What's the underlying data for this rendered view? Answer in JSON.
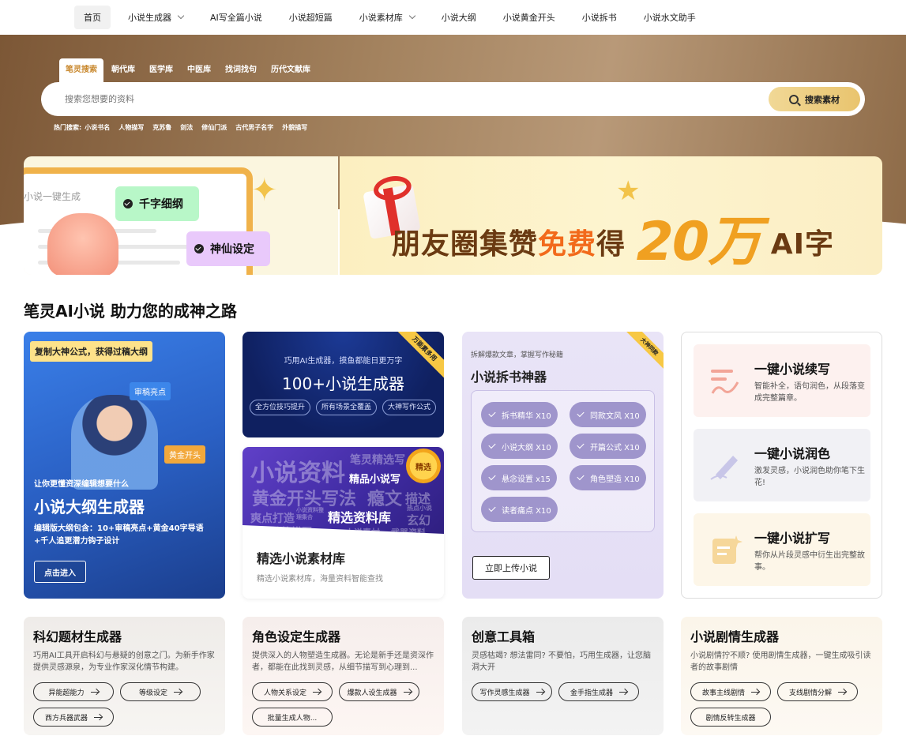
{
  "nav": {
    "items": [
      {
        "label": "首页",
        "dropdown": false,
        "active": true
      },
      {
        "label": "小说生成器",
        "dropdown": true,
        "active": false
      },
      {
        "label": "AI写全篇小说",
        "dropdown": false,
        "active": false
      },
      {
        "label": "小说超短篇",
        "dropdown": false,
        "active": false
      },
      {
        "label": "小说素材库",
        "dropdown": true,
        "active": false
      },
      {
        "label": "小说大纲",
        "dropdown": false,
        "active": false
      },
      {
        "label": "小说黄金开头",
        "dropdown": false,
        "active": false
      },
      {
        "label": "小说拆书",
        "dropdown": false,
        "active": false
      },
      {
        "label": "小说水文助手",
        "dropdown": false,
        "active": false
      }
    ]
  },
  "search": {
    "tabs": [
      "笔灵搜索",
      "朝代库",
      "医学库",
      "中医库",
      "找词找句",
      "历代文献库"
    ],
    "placeholder": "搜索您想要的资料",
    "button_label": "搜索素材",
    "hot_label": "热门搜索:",
    "hot_terms": [
      "小说书名",
      "人物描写",
      "克苏鲁",
      "剑法",
      "修仙门派",
      "古代男子名字",
      "外貌描写"
    ]
  },
  "banner_left": {
    "line_title": "小说一键生成",
    "tag1": "千字细纲",
    "tag2": "神仙设定"
  },
  "banner_right": {
    "text_part1": "朋友圈集赞",
    "text_free": "免费",
    "text_part2": "得",
    "text_big": "20万",
    "text_ai": "AI字"
  },
  "section_title": "笔灵AI小说 助力您的成神之路",
  "card_outline": {
    "badge": "复制大神公式，获得过稿大纲",
    "tag1": "审稿亮点",
    "tag2": "黄金开头",
    "subtitle": "让你更懂资深编辑想要什么",
    "title": "小说大纲生成器",
    "desc": "编辑版大纲包含：10+审稿亮点+黄金40字导语+千人追更潜力钩子设计",
    "button": "点击进入"
  },
  "card_generators": {
    "ribbon": "万能素多用",
    "subtitle": "巧用AI生成器，摸鱼都能日更万字",
    "title": "100+小说生成器",
    "pills": [
      "全方位技巧提升",
      "所有场景全覆盖",
      "大神写作公式"
    ]
  },
  "card_materials": {
    "medal": "精选",
    "words": [
      "小说资料",
      "笔灵精选写",
      "精品小说写",
      "黄金开头写法",
      "瘾文",
      "描述",
      "爽点打造",
      "小说资料整理集合",
      "精选资料库",
      "热点小说",
      "玄幻",
      "人物性格描写",
      "小说素材",
      "武器资料"
    ],
    "title": "精选小说素材库",
    "desc": "精选小说素材库，海量资料智能查找"
  },
  "card_breakdown": {
    "ribbon": "大神同款",
    "subtitle": "拆解爆款文章，掌握写作秘籍",
    "title": "小说拆书神器",
    "pills": [
      "拆书精华 X10",
      "同款文风 X10",
      "小说大纲 X10",
      "开篇公式 X10",
      "悬念设置 x15",
      "角色塑造 X10",
      "读者痛点 X10"
    ],
    "button": "立即上传小说"
  },
  "card_tools": {
    "items": [
      {
        "title": "一键小说续写",
        "desc": "智能补全，语句润色，从段落变成完整篇章。",
        "icon": "continue-writing-icon",
        "bg": "#fdf1ef",
        "icon_color": "#f2a598"
      },
      {
        "title": "一键小说润色",
        "desc": "激发灵感，小说润色助你笔下生花!",
        "icon": "polish-pen-icon",
        "bg": "#f1f1f5",
        "icon_color": "#c8c6e8"
      },
      {
        "title": "一键小说扩写",
        "desc": "帮你从片段灵感中衍生出完整故事。",
        "icon": "expand-doc-icon",
        "bg": "#fdf6e8",
        "icon_color": "#f6d79a"
      }
    ]
  },
  "bottom_cards": [
    {
      "title": "科幻题材生成器",
      "desc": "巧用AI工具开启科幻与悬疑的创意之门。为新手作家提供灵感源泉，为专业作家深化情节构建。",
      "pills": [
        "异能超能力",
        "等级设定",
        "西方兵器武器"
      ],
      "bg_start": "#efece9",
      "bg_end": "#f7f5f2"
    },
    {
      "title": "角色设定生成器",
      "desc": "提供深入的人物塑造生成器。无论是新手还是资深作者，都能在此找到灵感，从细节描写到心理到...",
      "pills": [
        "人物关系设定",
        "爆款人设生成器",
        "批量生成人物..."
      ],
      "bg_start": "#f6eeec",
      "bg_end": "#fdf6f3"
    },
    {
      "title": "创意工具箱",
      "desc": "灵感枯竭? 想法雷同? 不要怕，巧用生成器，让您脑洞大开",
      "pills": [
        "写作灵感生成器",
        "金手指生成器"
      ],
      "bg_start": "#ebebeb",
      "bg_end": "#f3f3f3"
    },
    {
      "title": "小说剧情生成器",
      "desc": "小说剧情拧不顺? 使用剧情生成器，一键生成吸引读者的故事剧情",
      "pills": [
        "故事主线剧情",
        "支线剧情分解",
        "剧情反转生成器"
      ],
      "bg_start": "#fbf5ea",
      "bg_end": "#fdf9f3"
    }
  ]
}
